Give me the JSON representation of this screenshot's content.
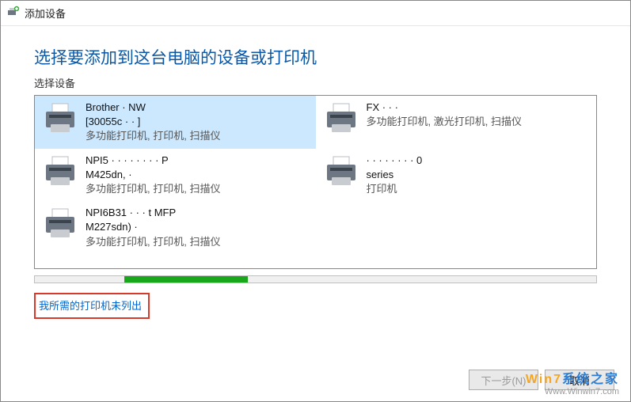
{
  "window": {
    "title": "添加设备"
  },
  "heading": "选择要添加到这台电脑的设备或打印机",
  "subheading": "选择设备",
  "devices": [
    {
      "name": "Brother   ·       NW",
      "mac": "[30055c   ·   ·   ]",
      "desc": "多功能打印机, 打印机, 扫描仪",
      "selected": true
    },
    {
      "name": "FX  ·   ·   ·",
      "mac": "",
      "desc": "多功能打印机, 激光打印机, 扫描仪",
      "selected": false
    },
    {
      "name": "NPI5   ·   ·   ·   ·   ·   ·   ·   ·   P",
      "mac": "M425dn,  ·",
      "desc": "多功能打印机, 打印机, 扫描仪",
      "selected": false
    },
    {
      "name": "·   ·   ·   ·   ·   ·   ·   ·   0",
      "mac": "series",
      "desc": "打印机",
      "selected": false
    },
    {
      "name": "NPI6B31   ·   ·   ·   t MFP",
      "mac": "M227sdn)  ·",
      "desc": "多功能打印机, 打印机, 扫描仪",
      "selected": false
    }
  ],
  "progress": {
    "start_pct": 16,
    "end_pct": 38
  },
  "link": "我所需的打印机未列出",
  "footer": {
    "next": "下一步(N)",
    "cancel": "取消"
  },
  "watermark": {
    "brand_prefix": "Win7",
    "brand_suffix": "系统之家",
    "url": "Www.Winwin7.com"
  }
}
